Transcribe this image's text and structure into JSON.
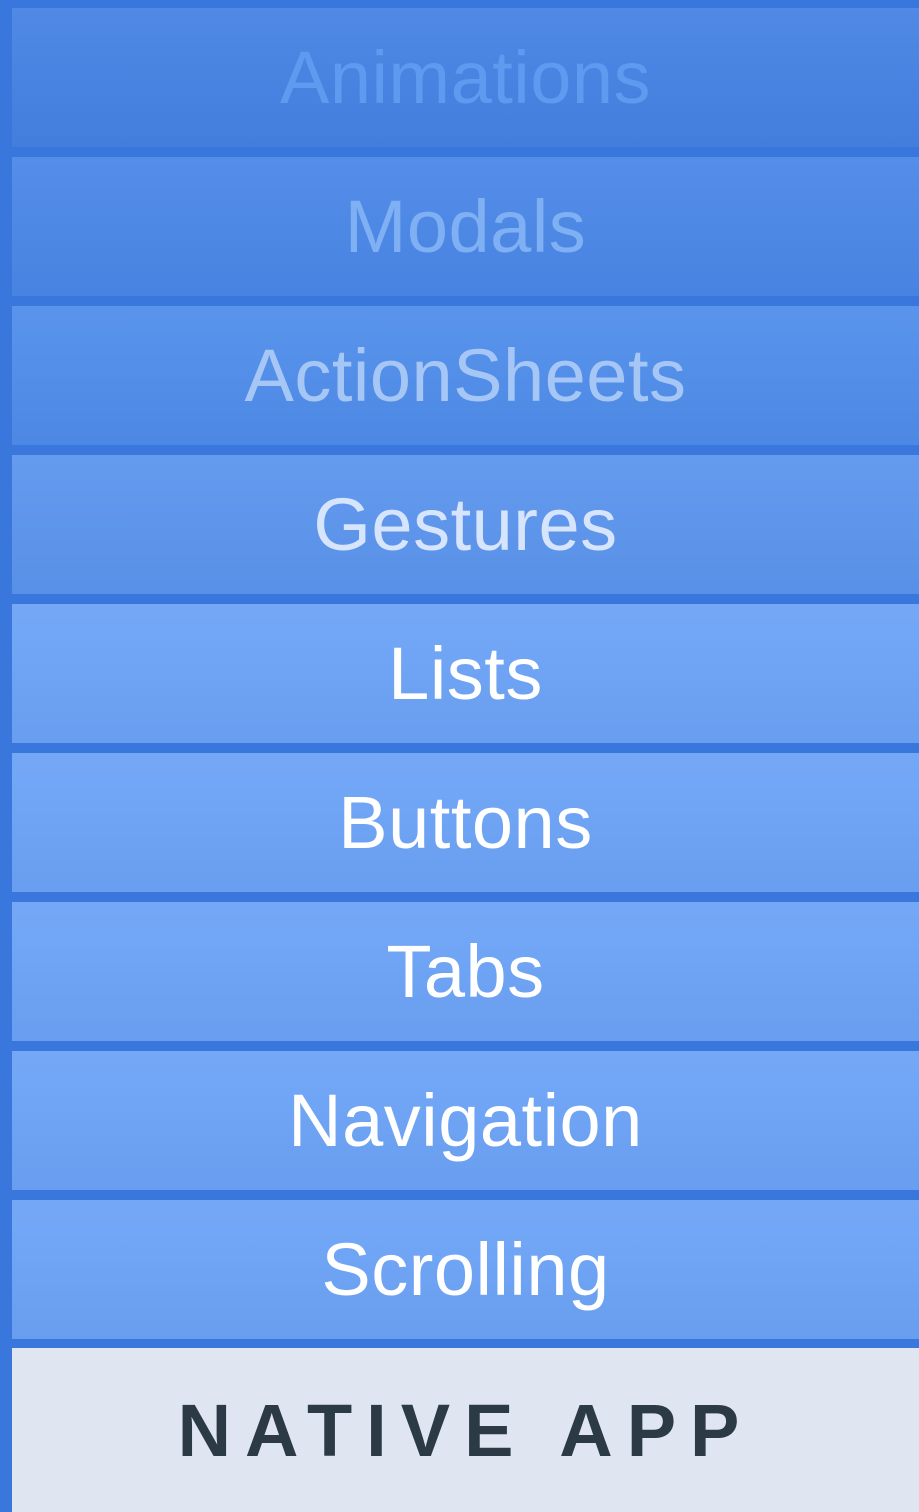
{
  "layers": [
    {
      "label": "Animations",
      "bg": "#4582e4",
      "fg": "#5f9af0"
    },
    {
      "label": "Modals",
      "bg": "#4a87e8",
      "fg": "#7fb0f3"
    },
    {
      "label": "ActionSheets",
      "bg": "#4f8deb",
      "fg": "#a6c7f6"
    },
    {
      "label": "Gestures",
      "bg": "#5b95ee",
      "fg": "#d6e5fb"
    },
    {
      "label": "Lists",
      "bg": "#6ca3f7",
      "fg": "#ffffff"
    },
    {
      "label": "Buttons",
      "bg": "#6ca3f7",
      "fg": "#ffffff"
    },
    {
      "label": "Tabs",
      "bg": "#6ca3f7",
      "fg": "#ffffff"
    },
    {
      "label": "Navigation",
      "bg": "#6ca3f7",
      "fg": "#ffffff"
    },
    {
      "label": "Scrolling",
      "bg": "#6ca3f7",
      "fg": "#ffffff"
    }
  ],
  "base": {
    "label": "NATIVE APP",
    "bg": "#dfe6f2",
    "fg": "#2c3a45"
  },
  "colors": {
    "divider": "#3a77dc"
  }
}
